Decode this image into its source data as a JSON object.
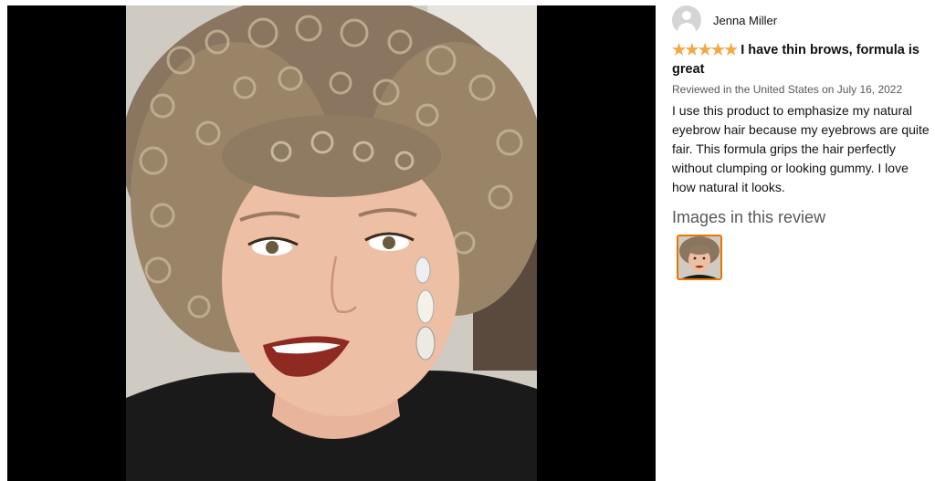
{
  "review": {
    "reviewer_name": "Jenna Miller",
    "stars_glyphs": "★★★★★",
    "rating": 5,
    "title": "I have thin brows, formula is great",
    "meta": "Reviewed in the United States on July 16, 2022",
    "body": "I use this product to emphasize my natural eyebrow hair because my eyebrows are quite fair. This formula grips the hair perfectly without clumping or looking gummy. I love how natural it looks.",
    "images_heading": "Images in this review"
  },
  "colors": {
    "star": "#f3a847",
    "thumb_border": "#e77600",
    "viewer_bg": "#000000"
  }
}
